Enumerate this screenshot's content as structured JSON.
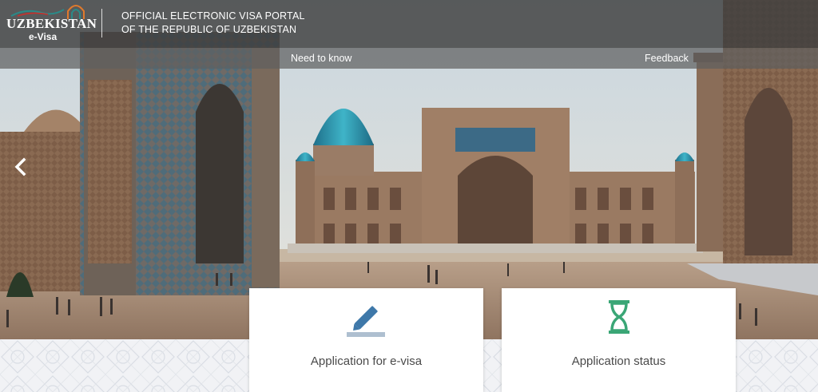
{
  "header": {
    "logo_word": "UZBEKISTAN",
    "logo_sub": "e-Visa",
    "portal_title_line1": "OFFICIAL ELECTRONIC VISA PORTAL",
    "portal_title_line2": "OF THE REPUBLIC OF UZBEKISTAN"
  },
  "nav": {
    "need_to_know": "Need to know",
    "feedback": "Feedback"
  },
  "cards": [
    {
      "label": "Application for e-visa",
      "icon": "pencil-icon"
    },
    {
      "label": "Application status",
      "icon": "hourglass-icon"
    }
  ],
  "colors": {
    "header_bg": "#3e3e3e",
    "icon_blue": "#3e78a9",
    "icon_green": "#3aa676",
    "card_text": "#4a4a4a",
    "logo_teal": "#2a8a88",
    "logo_orange": "#e07a2c"
  }
}
